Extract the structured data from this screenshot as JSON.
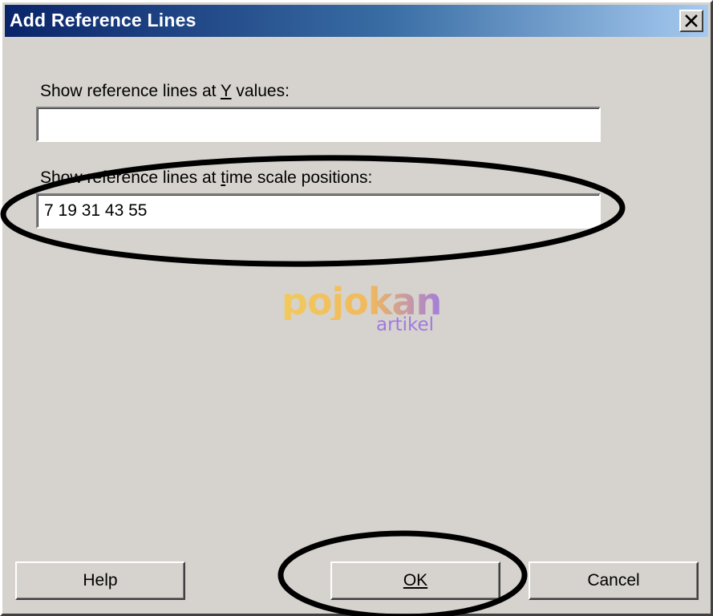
{
  "window": {
    "title": "Add Reference Lines",
    "close_icon": "close-icon"
  },
  "fields": {
    "y_values": {
      "label_prefix": "Show reference lines at ",
      "label_accel": "Y",
      "label_suffix": " values:",
      "value": ""
    },
    "time_scale": {
      "label_prefix": "Show reference lines at ",
      "label_accel": "t",
      "label_suffix": "ime scale positions:",
      "value": "7 19 31 43 55"
    }
  },
  "buttons": {
    "help": "Help",
    "ok": "OK",
    "cancel": "Cancel"
  },
  "watermark": {
    "main": "pojokan",
    "sub": "artikel"
  },
  "colors": {
    "dialog_bg": "#d6d3ce",
    "titlebar_start": "#0a246a",
    "titlebar_end": "#a6caf0",
    "annotation": "#000000"
  }
}
